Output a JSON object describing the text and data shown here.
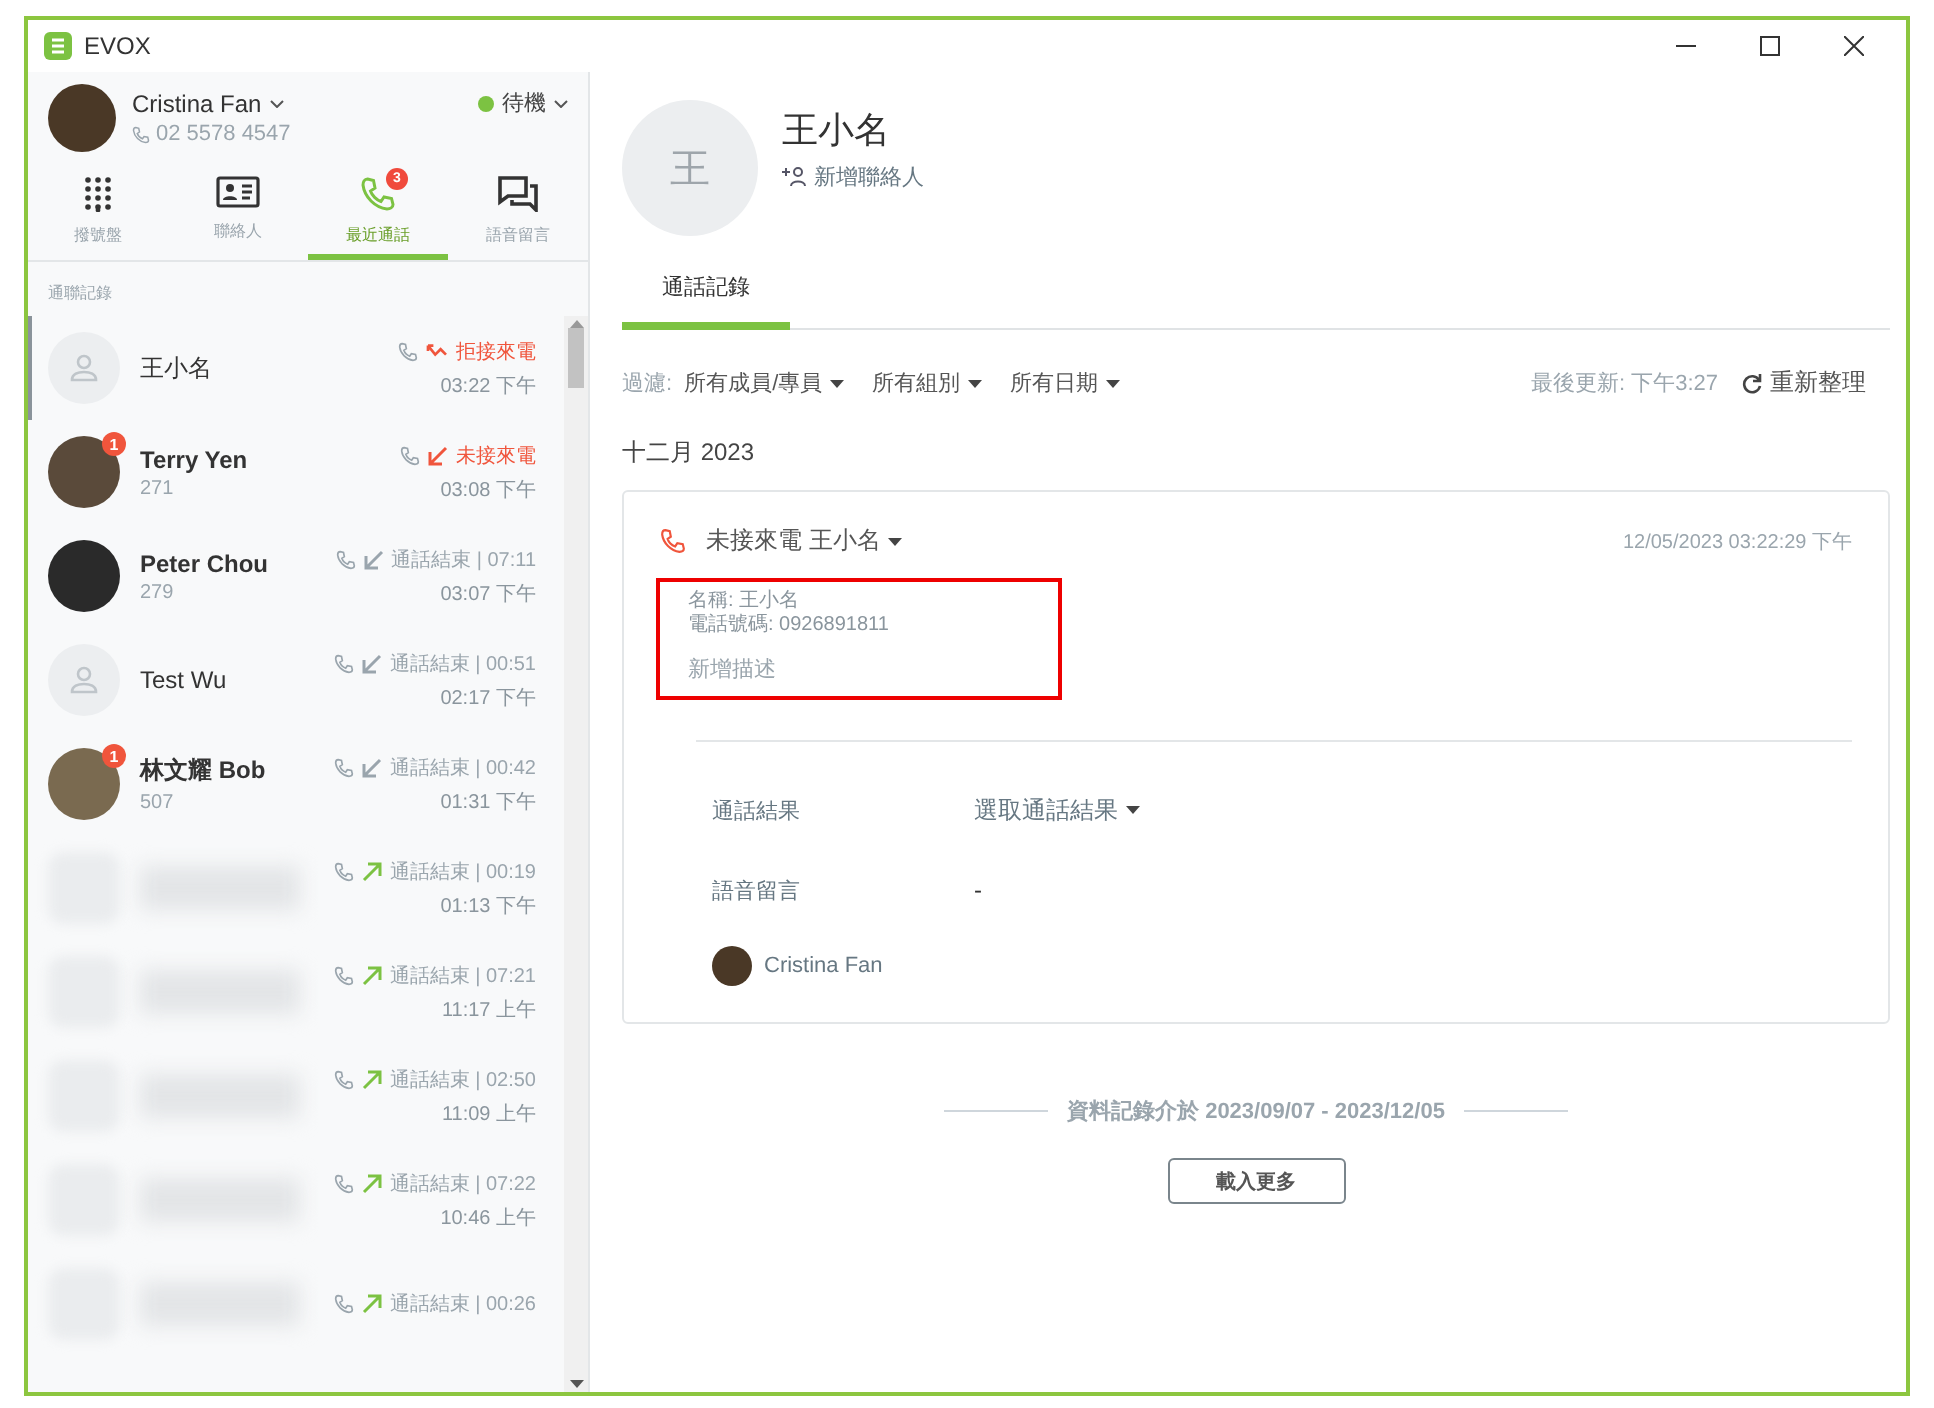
{
  "window": {
    "title": "EVOX"
  },
  "user": {
    "name": "Cristina Fan",
    "phone": "02 5578 4547",
    "status": "待機"
  },
  "nav": [
    {
      "kind": "dialpad",
      "label": "撥號盤",
      "selected": false
    },
    {
      "kind": "contacts",
      "label": "聯絡人",
      "selected": false
    },
    {
      "kind": "recent",
      "label": "最近通話",
      "selected": true,
      "badge": "3"
    },
    {
      "kind": "voicemail",
      "label": "語音留言",
      "selected": false
    }
  ],
  "list_title": "通聯記錄",
  "calls": [
    {
      "avatar": {
        "kind": "placeholder"
      },
      "name": "王小名",
      "kind": "rejected",
      "status": "拒接來電",
      "time": "03:22 下午",
      "selected": true
    },
    {
      "avatar": {
        "kind": "photo"
      },
      "name": "Terry Yen",
      "ext": "271",
      "unread": "1",
      "kind": "missed",
      "status": "未接來電",
      "time": "03:08 下午",
      "selected": false
    },
    {
      "avatar": {
        "kind": "photo"
      },
      "name": "Peter Chou",
      "ext": "279",
      "kind": "incoming",
      "status": "通話結束 | 07:11",
      "time": "03:07 下午",
      "selected": false
    },
    {
      "avatar": {
        "kind": "placeholder"
      },
      "name": "Test Wu",
      "kind": "incoming",
      "status": "通話結束 | 00:51",
      "time": "02:17 下午",
      "selected": false
    },
    {
      "avatar": {
        "kind": "photo"
      },
      "name": "林文耀 Bob",
      "ext": "507",
      "unread": "1",
      "kind": "incoming",
      "status": "通話結束 | 00:42",
      "time": "01:31 下午",
      "selected": false
    },
    {
      "avatar": {
        "kind": "blurred"
      },
      "kind": "outgoing",
      "status": "通話結束 | 00:19",
      "time": "01:13 下午",
      "selected": false
    },
    {
      "avatar": {
        "kind": "blurred"
      },
      "kind": "outgoing",
      "status": "通話結束 | 07:21",
      "time": "11:17 上午",
      "selected": false
    },
    {
      "avatar": {
        "kind": "blurred"
      },
      "kind": "outgoing",
      "status": "通話結束 | 02:50",
      "time": "11:09 上午",
      "selected": false
    },
    {
      "avatar": {
        "kind": "blurred"
      },
      "kind": "outgoing",
      "status": "通話結束 | 07:22",
      "time": "10:46 上午",
      "selected": false
    },
    {
      "avatar": {
        "kind": "blurred"
      },
      "kind": "outgoing",
      "status": "通話結束 | 00:26",
      "selected": false
    }
  ],
  "contact": {
    "initial": "王",
    "name": "王小名",
    "add_label": "新增聯絡人"
  },
  "tabs": [
    {
      "label": "通話記錄",
      "selected": true
    }
  ],
  "filter": {
    "label": "過濾:",
    "options": [
      "所有成員/專員",
      "所有組別",
      "所有日期"
    ],
    "updated": "最後更新: 下午3:27",
    "refresh": "重新整理"
  },
  "month": "十二月 2023",
  "record": {
    "kind": "missed",
    "title": "未接來電 王小名",
    "timestamp": "12/05/2023 03:22:29 下午",
    "details": [
      "名稱: 王小名",
      "電話號碼: 0926891811"
    ],
    "add_description": "新增描述",
    "fields": [
      {
        "label": "通話結果",
        "value": "選取通話結果",
        "kind": "dropdown"
      },
      {
        "label": "語音留言",
        "value": "-",
        "kind": "text"
      }
    ],
    "agent": "Cristina Fan"
  },
  "range": "資料記錄介於 2023/09/07 - 2023/12/05",
  "load_more": "載入更多"
}
